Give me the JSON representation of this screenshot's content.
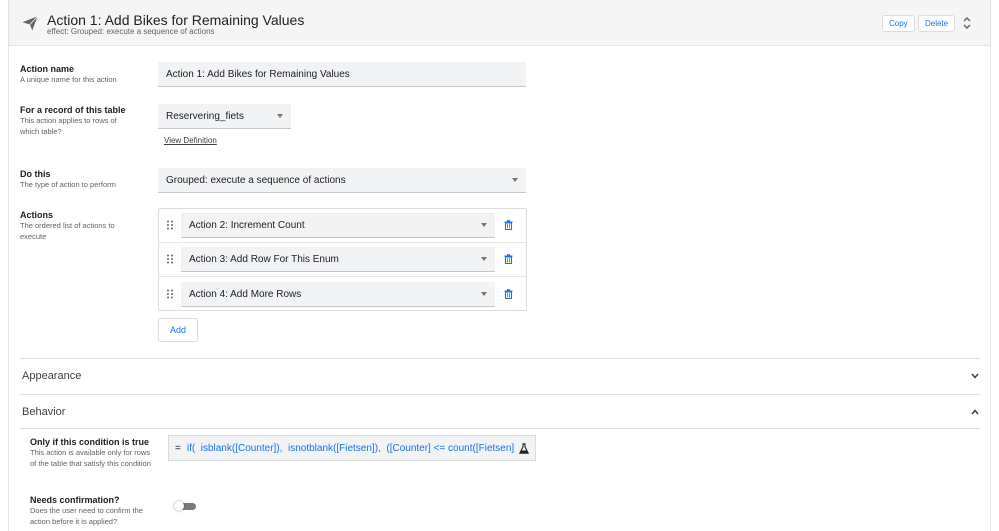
{
  "header": {
    "icon": "paper-plane-icon",
    "title": "Action 1: Add Bikes for Remaining Values",
    "subtitle": "effect: Grouped: execute a sequence of actions",
    "copy_label": "Copy",
    "delete_label": "Delete"
  },
  "fields": {
    "action_name": {
      "label": "Action name",
      "description": "A unique name for this action",
      "value": "Action 1: Add Bikes for Remaining Values"
    },
    "table": {
      "label": "For a record of this table",
      "description": "This action applies to rows of which table?",
      "value": "Reservering_fiets",
      "link": "View Definition"
    },
    "do_this": {
      "label": "Do this",
      "description": "The type of action to perform",
      "value": "Grouped: execute a sequence of actions"
    },
    "actions": {
      "label": "Actions",
      "description": "The ordered list of actions to execute",
      "items": [
        {
          "value": "Action 2: Increment Count"
        },
        {
          "value": "Action 3: Add Row For This Enum"
        },
        {
          "value": "Action 4: Add More Rows"
        }
      ],
      "add_label": "Add"
    }
  },
  "sections": {
    "appearance": {
      "title": "Appearance",
      "expanded": false
    },
    "behavior": {
      "title": "Behavior",
      "expanded": true
    }
  },
  "behavior": {
    "condition": {
      "label": "Only if this condition is true",
      "description": "This action is available only for rows of the table that satisfy this condition",
      "eq": "=",
      "formula": "if(  isblank([Counter]),  isnotblank([Fietsen]),  ([Counter] <= count([Fietsen]"
    },
    "confirmation": {
      "label": "Needs confirmation?",
      "description": "Does the user need to confirm the action before it is applied?",
      "enabled": false
    }
  },
  "colors": {
    "accent": "#1a73e8",
    "header_bg": "#f5f5f5",
    "input_bg": "#f1f3f4"
  }
}
